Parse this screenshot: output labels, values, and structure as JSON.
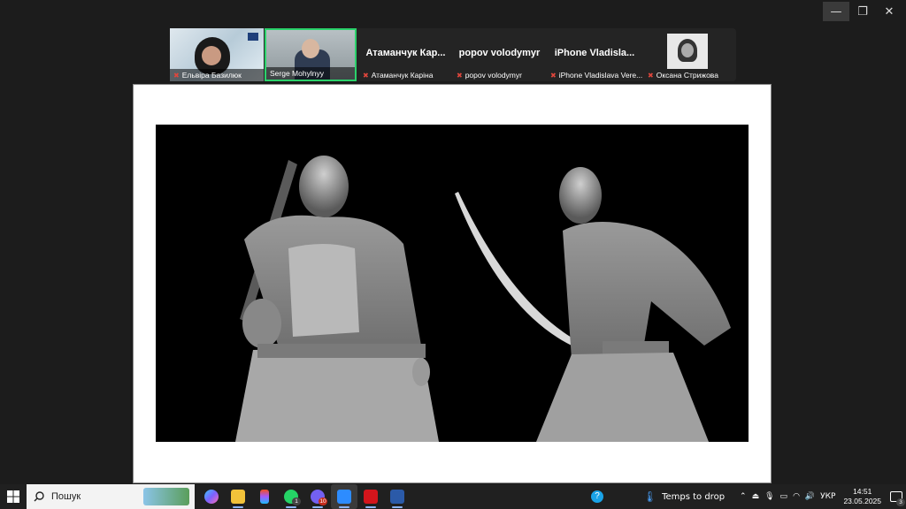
{
  "window_controls": {
    "minimize": "—",
    "restore": "❐",
    "close": "✕"
  },
  "participants": [
    {
      "name": "Ельвіра Базилюк",
      "muted": true,
      "type": "video"
    },
    {
      "name": "Serge Mohylnyy",
      "muted": false,
      "type": "video",
      "speaking": true
    },
    {
      "display": "Атаманчук Кар...",
      "name": "Атаманчук Каріна",
      "muted": true,
      "type": "name"
    },
    {
      "display": "popov volodymyr",
      "name": "popov volodymyr",
      "muted": true,
      "type": "name"
    },
    {
      "display": "iPhone Vladisla...",
      "name": "iPhone Vladislava Vere...",
      "muted": true,
      "type": "name"
    },
    {
      "name": "Оксана Стрижова",
      "muted": true,
      "type": "photo"
    }
  ],
  "taskbar": {
    "search_placeholder": "Пошук",
    "apps": [
      {
        "name": "copilot-icon",
        "color": "#7b61ff"
      },
      {
        "name": "file-explorer-icon",
        "color": "#f2c23a"
      },
      {
        "name": "figma-icon",
        "color": "#a259ff"
      },
      {
        "name": "whatsapp-icon",
        "color": "#25d366",
        "badge": "1"
      },
      {
        "name": "viber-icon",
        "color": "#7360f2",
        "badge": "10"
      },
      {
        "name": "zoom-icon",
        "color": "#2d8cff",
        "active": true
      },
      {
        "name": "acrobat-icon",
        "color": "#d4151c"
      },
      {
        "name": "word-icon",
        "color": "#2b5aa8"
      }
    ],
    "weather": "Temps to drop",
    "language": "УКР",
    "time": "14:51",
    "date": "23.05.2025",
    "notifications": "3"
  }
}
